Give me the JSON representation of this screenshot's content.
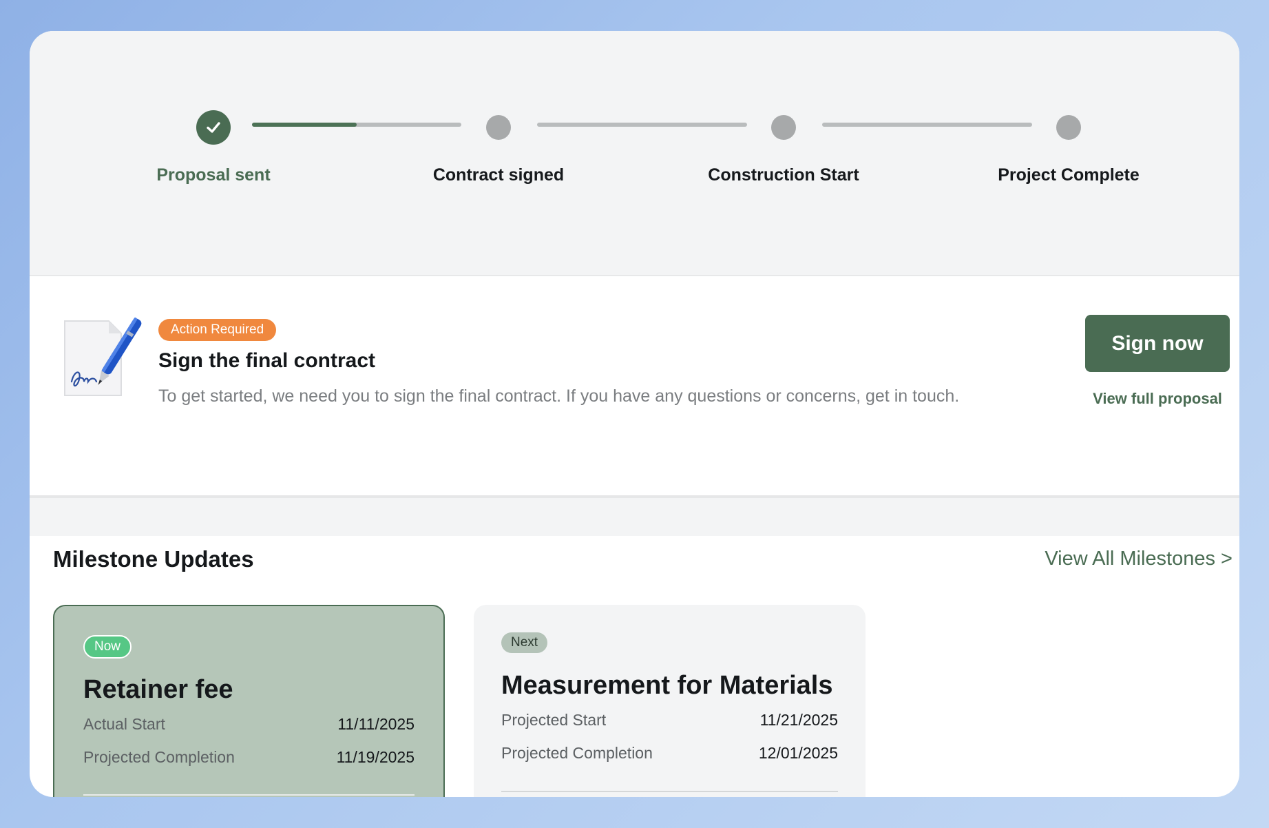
{
  "progress": {
    "steps": [
      {
        "label": "Proposal sent",
        "status": "done"
      },
      {
        "label": "Contract signed",
        "status": "pending"
      },
      {
        "label": "Construction Start",
        "status": "pending"
      },
      {
        "label": "Project Complete",
        "status": "pending"
      }
    ],
    "first_segment_progress": 0.5,
    "accent_color": "#4a6c53",
    "pending_color": "#a7a9aa"
  },
  "action": {
    "badge": "Action Required",
    "badge_color": "#f0883e",
    "title": "Sign the final contract",
    "description": "To get started, we need you to sign the final contract. If you have any questions or concerns, get in touch.",
    "primary_button": "Sign now",
    "secondary_link": "View full proposal"
  },
  "milestones": {
    "title": "Milestone Updates",
    "view_all": "View All Milestones >",
    "cards": [
      {
        "badge": "Now",
        "title": "Retainer fee",
        "rows": [
          {
            "label": "Actual Start",
            "value": "11/11/2025"
          },
          {
            "label": "Projected Completion",
            "value": "11/19/2025"
          }
        ]
      },
      {
        "badge": "Next",
        "title": "Measurement for Materials",
        "rows": [
          {
            "label": "Projected Start",
            "value": "11/21/2025"
          },
          {
            "label": "Projected Completion",
            "value": "12/01/2025"
          }
        ]
      }
    ]
  }
}
